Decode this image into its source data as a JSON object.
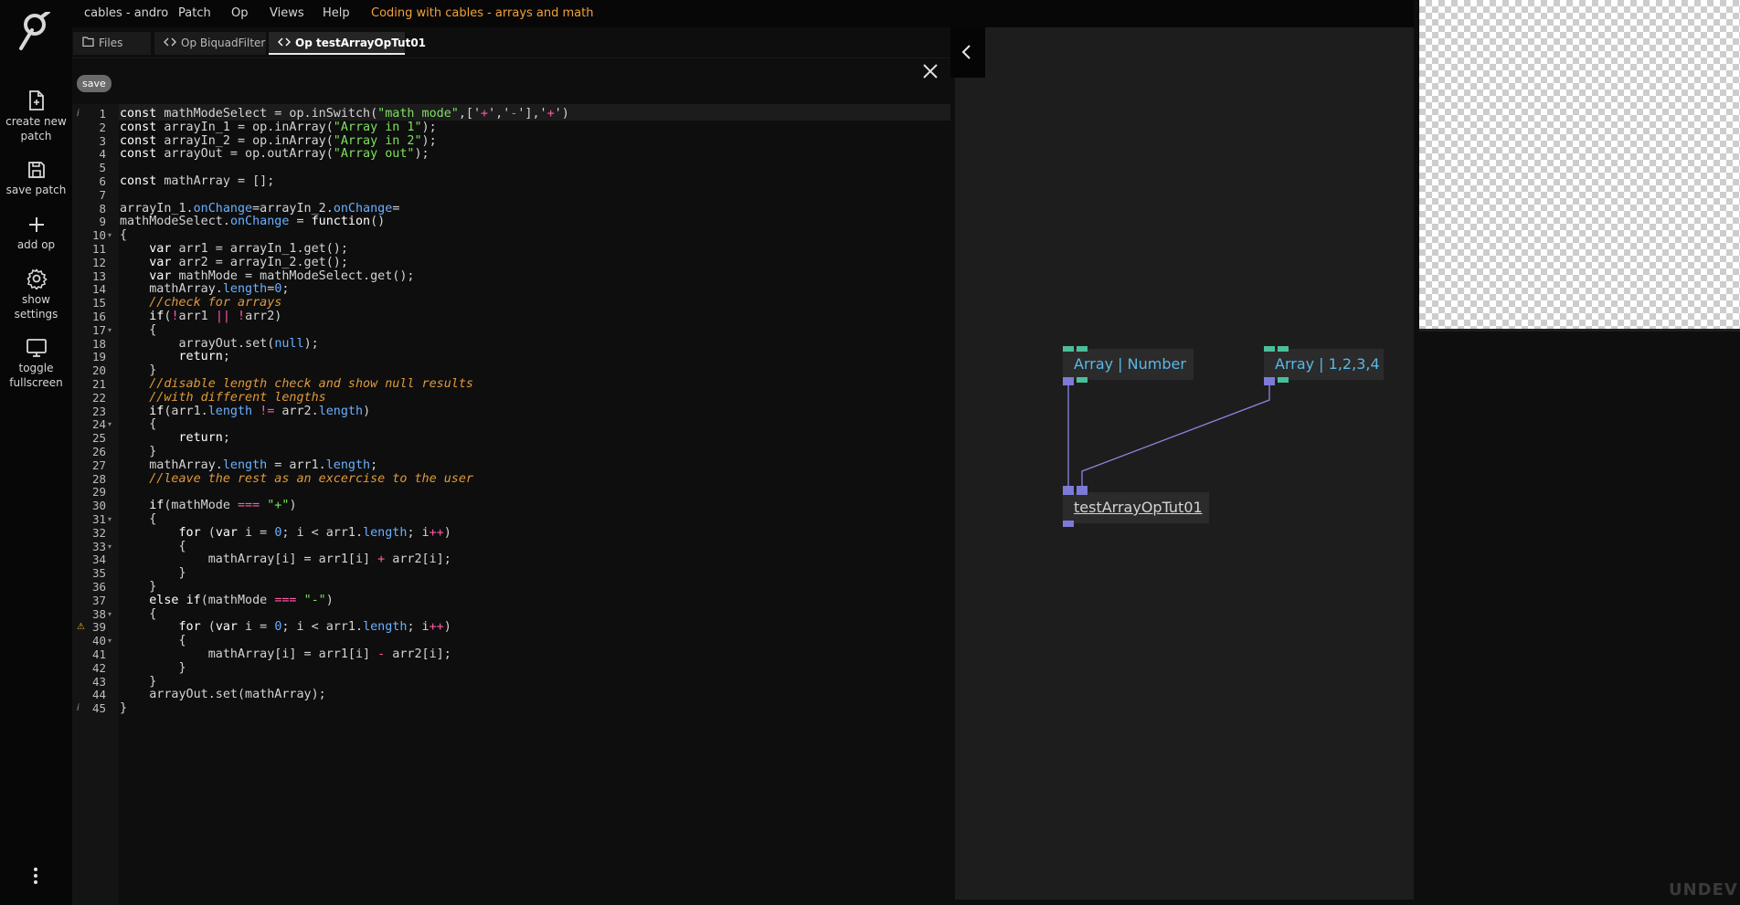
{
  "menubar": {
    "app": "cables - andro",
    "items": [
      "Patch",
      "Op",
      "Views",
      "Help"
    ],
    "patch_title": "Coding with cables - arrays and math"
  },
  "sidebar": {
    "items": [
      {
        "icon": "file-plus-icon",
        "label": "create new\npatch"
      },
      {
        "icon": "floppy-icon",
        "label": "save patch"
      },
      {
        "icon": "plus-icon",
        "label": "add op"
      },
      {
        "icon": "gear-icon",
        "label": "show\nsettings"
      },
      {
        "icon": "monitor-icon",
        "label": "toggle\nfullscreen"
      }
    ]
  },
  "tabs": [
    {
      "label": "Files",
      "icon": "folder-icon"
    },
    {
      "label": "Op BiquadFilter",
      "icon": "code-icon"
    },
    {
      "label": "Op testArrayOpTut01",
      "icon": "code-icon",
      "active": true
    }
  ],
  "editor": {
    "save_label": "save",
    "line_numbers": [
      "1",
      "2",
      "3",
      "4",
      "5",
      "6",
      "7",
      "8",
      "9",
      "10",
      "11",
      "12",
      "13",
      "14",
      "15",
      "16",
      "17",
      "18",
      "19",
      "20",
      "21",
      "22",
      "23",
      "24",
      "25",
      "26",
      "27",
      "28",
      "29",
      "30",
      "31",
      "32",
      "33",
      "34",
      "35",
      "36",
      "37",
      "38",
      "39",
      "40",
      "41",
      "42",
      "43",
      "44",
      "45"
    ],
    "code_lines": [
      "const mathModeSelect = op.inSwitch(\"math mode\",['+','-'],'+')",
      "const arrayIn_1 = op.inArray(\"Array in 1\");",
      "const arrayIn_2 = op.inArray(\"Array in 2\");",
      "const arrayOut = op.outArray(\"Array out\");",
      "",
      "const mathArray = [];",
      "",
      "arrayIn_1.onChange=arrayIn_2.onChange=",
      "mathModeSelect.onChange = function()",
      "{",
      "    var arr1 = arrayIn_1.get();",
      "    var arr2 = arrayIn_2.get();",
      "    var mathMode = mathModeSelect.get();",
      "    mathArray.length=0;",
      "    //check for arrays",
      "    if(!arr1 || !arr2)",
      "    {",
      "        arrayOut.set(null);",
      "        return;",
      "    }",
      "    //disable length check and show null results",
      "    //with different lengths",
      "    if(arr1.length != arr2.length)",
      "    {",
      "        return;",
      "    }",
      "    mathArray.length = arr1.length;",
      "    //leave the rest as an excercise to the user",
      "",
      "    if(mathMode === \"+\")",
      "    {",
      "        for (var i = 0; i < arr1.length; i++)",
      "        {",
      "            mathArray[i] = arr1[i] + arr2[i];",
      "        }",
      "    }",
      "    else if(mathMode === \"-\")",
      "    {",
      "        for (var i = 0; i < arr1.length; i++)",
      "        {",
      "            mathArray[i] = arr1[i] - arr2[i];",
      "        }",
      "    }",
      "    arrayOut.set(mathArray);",
      "}"
    ]
  },
  "patch": {
    "nodes": [
      {
        "id": "array-number",
        "label": "Array | Number"
      },
      {
        "id": "array-1234",
        "label": "Array | 1,2,3,4"
      },
      {
        "id": "test-op",
        "label": "testArrayOpTut01"
      }
    ]
  },
  "watermark": "UNDEV",
  "colors": {
    "accent": "#f0a23a",
    "node_text": "#5ab8e6",
    "port_in": "#4cbd9a",
    "port_array": "#7d7ad8"
  }
}
